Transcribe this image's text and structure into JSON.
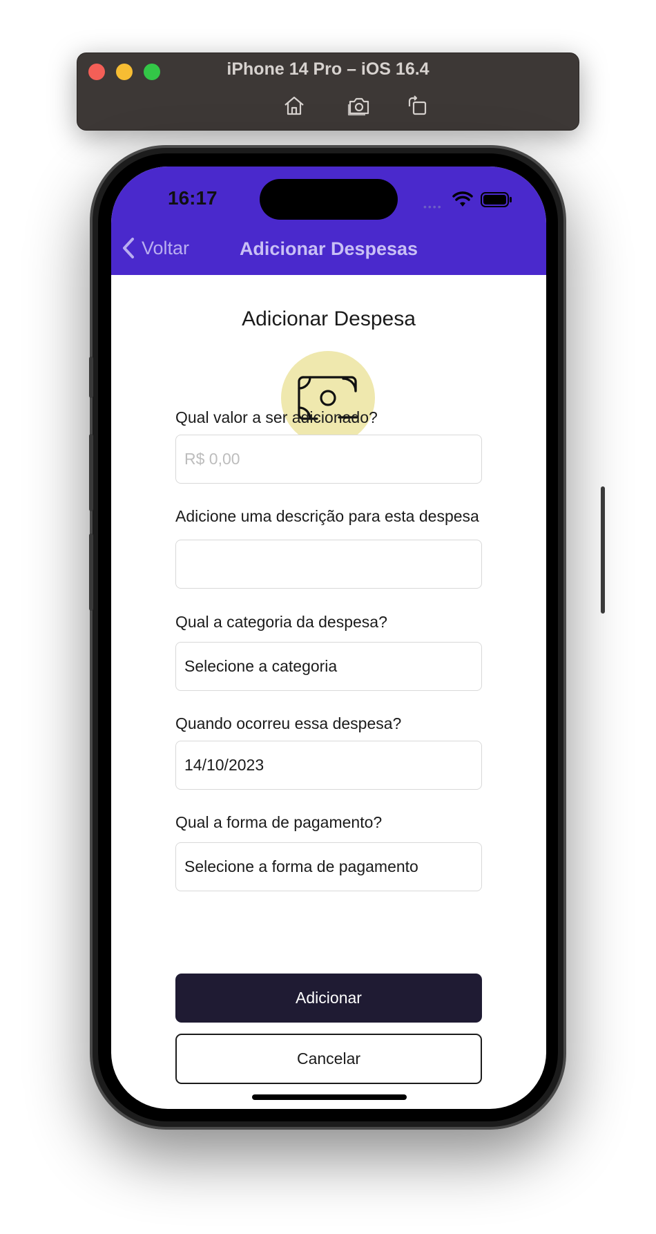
{
  "simulator": {
    "title": "iPhone 14 Pro – iOS 16.4",
    "tools": [
      "home-icon",
      "screenshot-icon",
      "rotate-icon"
    ]
  },
  "status_bar": {
    "time": "16:17",
    "signal": "••••"
  },
  "nav": {
    "back_label": "Voltar",
    "title": "Adicionar Despesas"
  },
  "form": {
    "title": "Adicionar Despesa",
    "icon": "money-bill-icon",
    "amount_label": "Qual valor a ser adicionado?",
    "amount_placeholder": "R$ 0,00",
    "description_label": "Adicione uma descrição para esta despesa",
    "description_value": "",
    "category_label": "Qual a categoria da despesa?",
    "category_value": "Selecione a categoria",
    "date_label": "Quando ocorreu essa despesa?",
    "date_value": "14/10/2023",
    "payment_label": "Qual a forma de pagamento?",
    "payment_value": "Selecione a forma de pagamento",
    "submit_label": "Adicionar",
    "cancel_label": "Cancelar"
  },
  "colors": {
    "header": "#4a29cc",
    "primary_button": "#1f1b33",
    "icon_badge": "#efe8ae"
  }
}
